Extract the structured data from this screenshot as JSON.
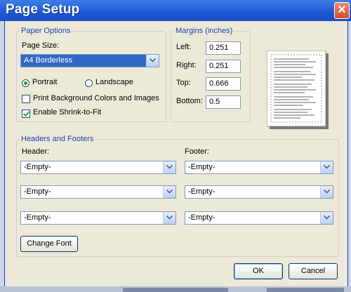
{
  "window": {
    "title": "Page Setup",
    "close_glyph": "✕",
    "accent": "#1c57d3"
  },
  "paper_options": {
    "legend": "Paper Options",
    "page_size_label": "Page Size:",
    "page_size_value": "A4 Borderless",
    "orientation": {
      "portrait_label": "Portrait",
      "landscape_label": "Landscape",
      "selected": "Portrait"
    },
    "print_background_label": "Print Background Colors and Images",
    "print_background_checked": false,
    "shrink_to_fit_label": "Enable Shrink-to-Fit",
    "shrink_to_fit_checked": true
  },
  "margins": {
    "legend": "Margins (inches)",
    "left_label": "Left:",
    "left_value": "0.251",
    "right_label": "Right:",
    "right_value": "0.251",
    "top_label": "Top:",
    "top_value": "0.666",
    "bottom_label": "Bottom:",
    "bottom_value": "0.5"
  },
  "headers_footers": {
    "legend": "Headers and Footers",
    "header_label": "Header:",
    "footer_label": "Footer:",
    "headers": [
      "-Empty-",
      "-Empty-",
      "-Empty-"
    ],
    "footers": [
      "-Empty-",
      "-Empty-",
      "-Empty-"
    ],
    "change_font_label": "Change Font"
  },
  "buttons": {
    "ok_label": "OK",
    "cancel_label": "Cancel"
  },
  "icons": {
    "dropdown": "chevron-down-icon",
    "close": "close-icon",
    "check": "checkmark-icon"
  }
}
